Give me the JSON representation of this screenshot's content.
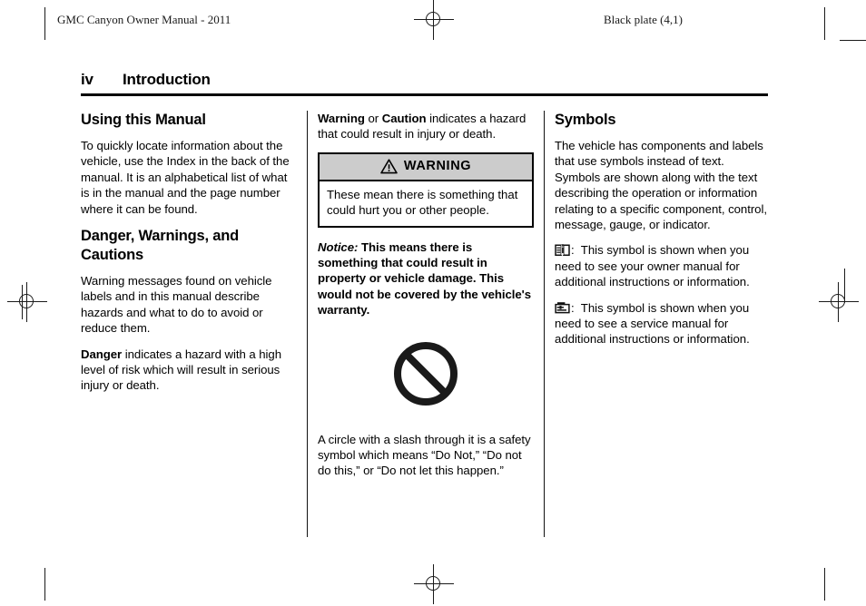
{
  "page": {
    "header_left": "GMC Canyon Owner Manual - 2011",
    "header_right": "Black plate (4,1)",
    "folio": "iv",
    "section_title": "Introduction"
  },
  "left_column": {
    "heading_1": "Using this Manual",
    "paragraph_1": "To quickly locate information about the vehicle, use the Index in the back of the manual. It is an alphabetical list of what is in the manual and the page number where it can be found.",
    "heading_2": "Danger, Warnings, and Cautions",
    "paragraph_2": "Warning messages found on vehicle labels and in this manual describe hazards and what to do to avoid or reduce them.",
    "paragraph_3_lead": "Danger",
    "paragraph_3_rest": " indicates a hazard with a high level of risk which will result in serious injury or death."
  },
  "middle_column": {
    "paragraph_1_lead_a": "Warning",
    "paragraph_1_mid": " or ",
    "paragraph_1_lead_b": "Caution",
    "paragraph_1_rest": " indicates a hazard that could result in injury or death.",
    "warning_box": {
      "icon": "warning-triangle-icon",
      "title": "WARNING",
      "body": "These mean there is something that could hurt you or other people."
    },
    "notice_lead": "Notice:",
    "notice_rest": " This means there is something that could result in property or vehicle damage. This would not be covered by the vehicle's warranty.",
    "graphic": "circle-slash-icon",
    "paragraph_2": "A circle with a slash through it is a safety symbol which means “Do Not,” “Do not do this,” or “Do not let this happen.”"
  },
  "right_column": {
    "heading": "Symbols",
    "paragraph_1": "The vehicle has components and labels that use symbols instead of text. Symbols are shown along with the text describing the operation or information relating to a specific component, control, message, gauge, or indicator.",
    "symbol_1": {
      "icon": "owner-manual-book-icon",
      "colon": ":",
      "text": "This symbol is shown when you need to see your owner manual for additional instructions or information."
    },
    "symbol_2": {
      "icon": "service-manual-icon",
      "colon": ":",
      "text": "This symbol is shown when you need to see a service manual for additional instructions or information."
    }
  },
  "colors": {
    "warning_header_bg": "#cccccc",
    "rule": "#000000",
    "text": "#000000",
    "mark": "#1a1a1a"
  }
}
